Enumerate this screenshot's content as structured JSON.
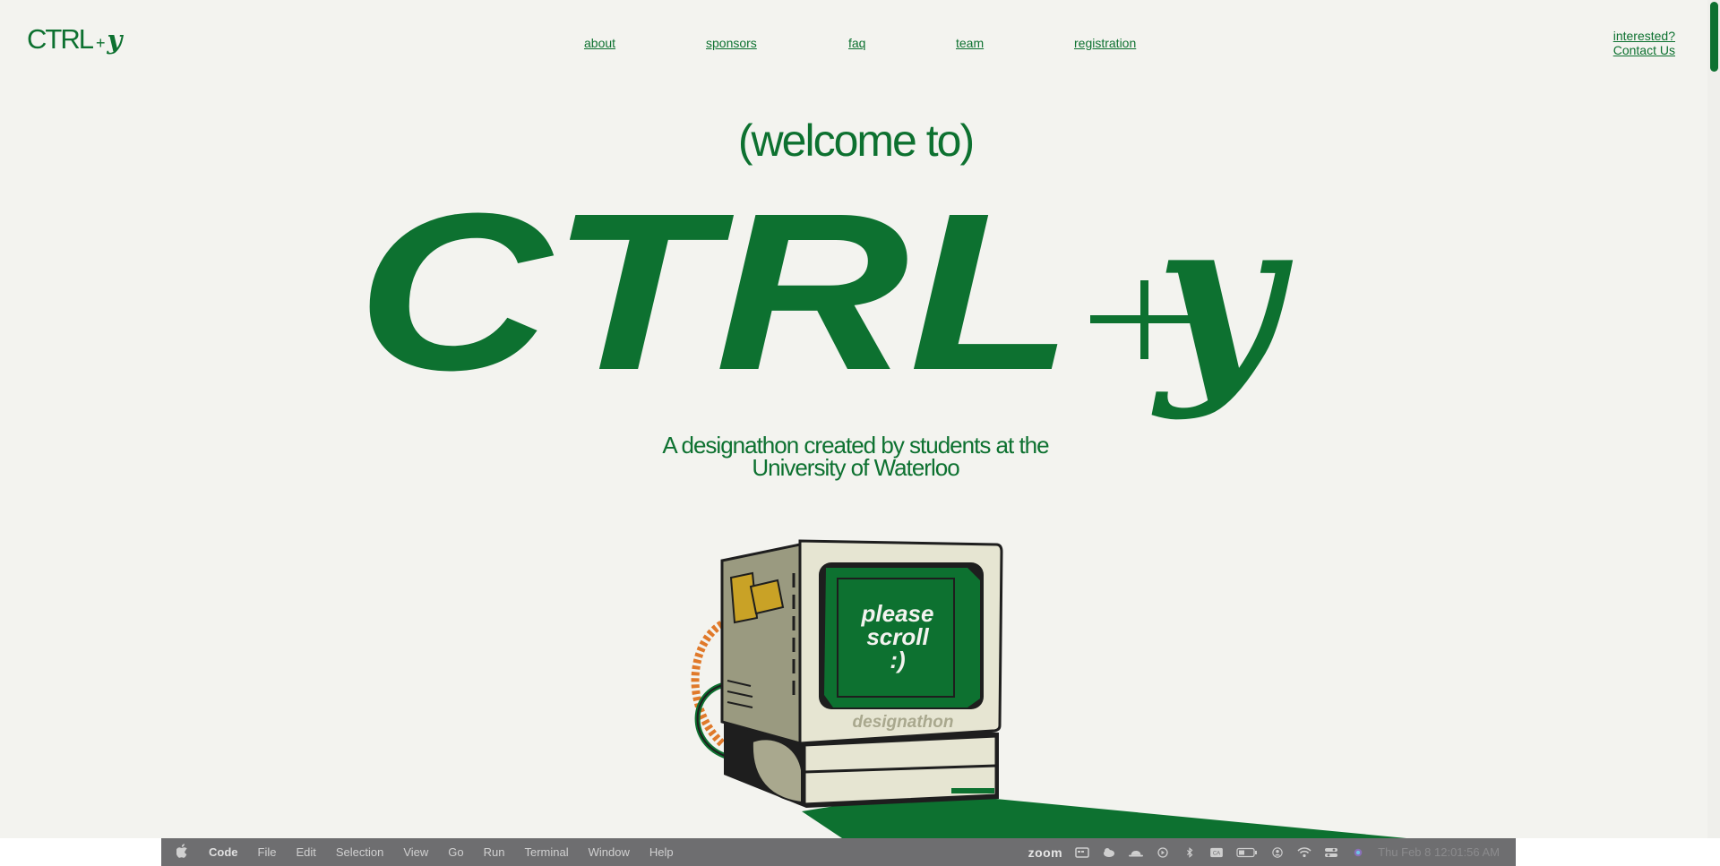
{
  "logo": {
    "ctrl": "CTRL",
    "plus": "+",
    "y": "y"
  },
  "nav": {
    "about": "about",
    "sponsors": "sponsors",
    "faq": "faq",
    "team": "team",
    "registration": "registration"
  },
  "contact": {
    "line1": "interested?",
    "line2": "Contact Us"
  },
  "hero": {
    "welcome": "(welcome to)",
    "title_ctrl": "CTRL",
    "title_plus": "+",
    "title_y": "y",
    "tagline_line1": "A designathon created by students at the",
    "tagline_line2": "University of Waterloo"
  },
  "computer": {
    "screen_line1": "please",
    "screen_line2": "scroll",
    "screen_line3": ":)",
    "brand": "designathon"
  },
  "menubar": {
    "apple": "",
    "app_name": "Code",
    "items": [
      "File",
      "Edit",
      "Selection",
      "View",
      "Go",
      "Run",
      "Terminal",
      "Window",
      "Help"
    ],
    "zoom": "zoom",
    "clock": "Thu Feb 8  12:01:56 AM"
  },
  "colors": {
    "brand_green": "#0d7130",
    "background": "#f3f3ef",
    "menubar": "#6e6e70"
  }
}
